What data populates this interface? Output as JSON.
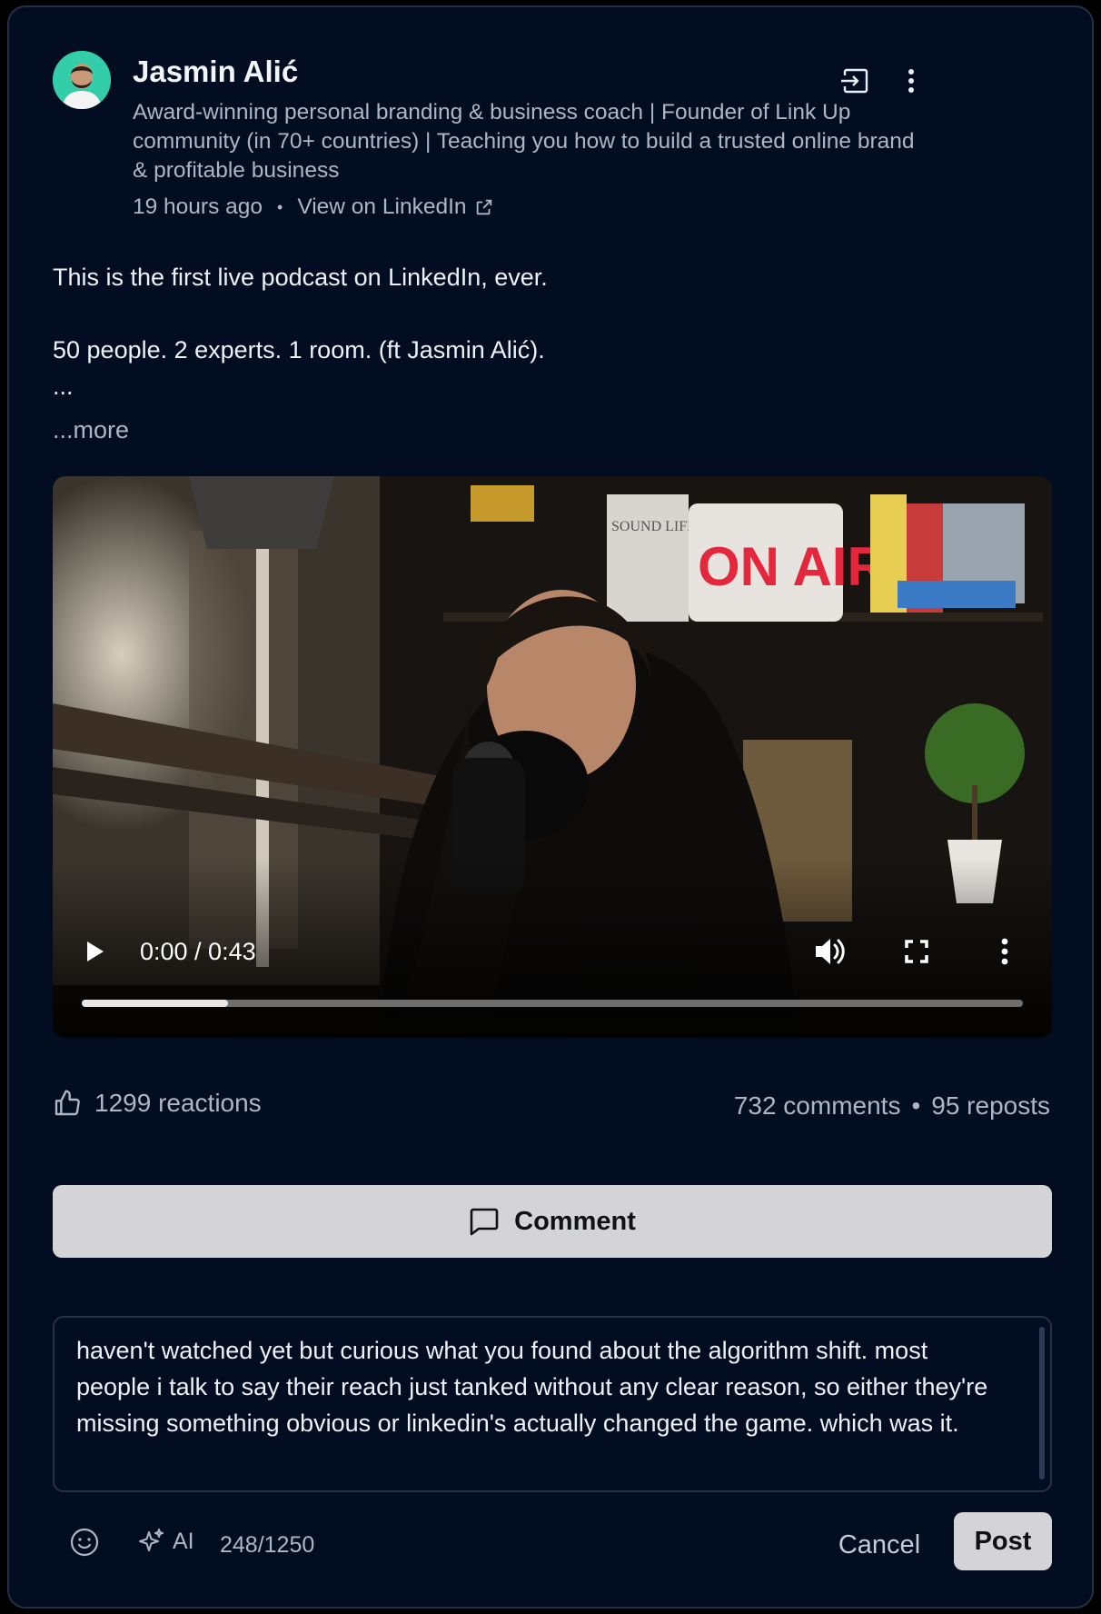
{
  "post": {
    "author": {
      "name": "Jasmin Alić",
      "headline": "Award-winning personal branding & business coach | Founder of Link Up community (in 70+ countries) | Teaching you how to build a trusted online brand & profitable business"
    },
    "timestamp": "19 hours ago",
    "separator": "•",
    "view_link": "View on LinkedIn",
    "text_line1": "This is the first live podcast on LinkedIn, ever.",
    "text_line2": "50 people. 2 experts. 1 room. (ft Jasmin Alić).",
    "text_ellipsis": "...",
    "more_label": "...more"
  },
  "video": {
    "time_display": "0:00 / 0:43",
    "progress_fraction": 0.155,
    "scene_sign_text": "ON AIR",
    "scene_book_text": "SOUND LIFELINE"
  },
  "stats": {
    "reactions": "1299 reactions",
    "comments": "732 comments",
    "separator": "•",
    "reposts": "95 reposts"
  },
  "actions": {
    "comment_label": "Comment"
  },
  "composer": {
    "text": "haven't watched yet but curious what you found about the algorithm shift. most people i talk to say their reach just tanked without any clear reason, so either they're missing something obvious or linkedin's actually changed the game. which was it.",
    "ai_label": "AI",
    "char_count": "248/1250",
    "cancel_label": "Cancel",
    "post_label": "Post"
  },
  "colors": {
    "card_bg": "#020d22",
    "muted_text": "#aeb6c6",
    "button_bg": "#d4d4d6",
    "avatar_bg": "#2fc9a6"
  }
}
